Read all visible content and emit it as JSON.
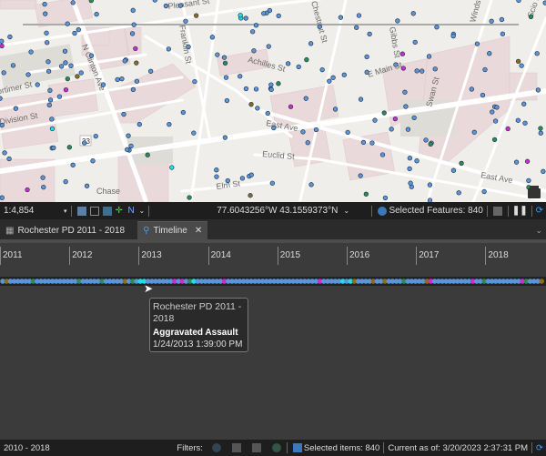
{
  "map": {
    "streets": [
      "Pleasant St",
      "N Clinton Ave",
      "Franklin St",
      "Achilles St",
      "E Main St",
      "East Ave",
      "Euclid St",
      "Elm St",
      "Division St",
      "Mortimer St",
      "Chestnut St",
      "Gibbs St",
      "Swan St",
      "Windsor St",
      "Scio St",
      "Chase",
      "33"
    ],
    "colors": {
      "bg": "#efeeea",
      "block": "#ead9da",
      "road": "#ffffff",
      "dot": "#5b95dc",
      "dot_green": "#2e8b57",
      "dot_magenta": "#d22ad2",
      "dot_cyan": "#1ee0e8",
      "dot_olive": "#8a6d1e"
    }
  },
  "toolbar": {
    "scale": "1:4,854",
    "coords": "77.6043256°W 43.1559373°N",
    "selected_features": "Selected Features: 840"
  },
  "tabs": [
    {
      "label": "Rochester PD 2011 - 2018"
    },
    {
      "label": "Timeline",
      "close": "✕"
    }
  ],
  "timeline": {
    "years": [
      "2011",
      "2012",
      "2013",
      "2014",
      "2015",
      "2016",
      "2017",
      "2018"
    ],
    "tooltip": {
      "layer": "Rochester PD 2011 - 2018",
      "type": "Aggravated Assault",
      "datetime": "1/24/2013 1:39:00 PM"
    }
  },
  "status": {
    "range": "2010 - 2018",
    "filters_label": "Filters:",
    "selected_items": "Selected items: 840",
    "current_as_of": "Current as of: 3/20/2023 2:37:31 PM"
  }
}
